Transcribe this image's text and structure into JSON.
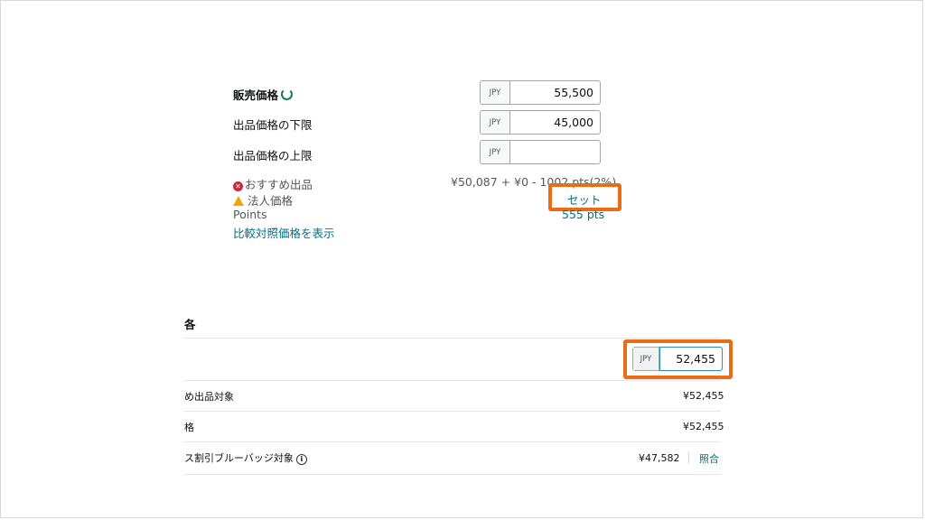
{
  "top": {
    "sale_price": {
      "label": "販売価格",
      "currency": "JPY",
      "value": "55,500"
    },
    "min_price": {
      "label": "出品価格の下限",
      "currency": "JPY",
      "value": "45,000"
    },
    "max_price": {
      "label": "出品価格の上限",
      "currency": "JPY",
      "value": ""
    },
    "recommended": {
      "label": "おすすめ出品",
      "value": "¥50,087 + ¥0 - 1002 pts(2%)"
    },
    "business_price": {
      "label": "法人価格",
      "action": "セット"
    },
    "points": {
      "label": "Points",
      "value": "555 pts"
    },
    "compare_link": "比較対照価格を表示"
  },
  "section2": {
    "heading": "各",
    "price_input": {
      "currency": "JPY",
      "value": "52,455"
    },
    "rows": [
      {
        "label": "め出品対象",
        "value": "¥52,455"
      },
      {
        "label": "格",
        "value": "¥52,455"
      },
      {
        "label": "ス割引ブルーバッジ対象",
        "value": "¥47,582",
        "link": "照合"
      }
    ]
  },
  "colors": {
    "highlight": "#ea6c14",
    "link": "#007185",
    "error": "#c7283b",
    "warning": "#f0a30a"
  }
}
